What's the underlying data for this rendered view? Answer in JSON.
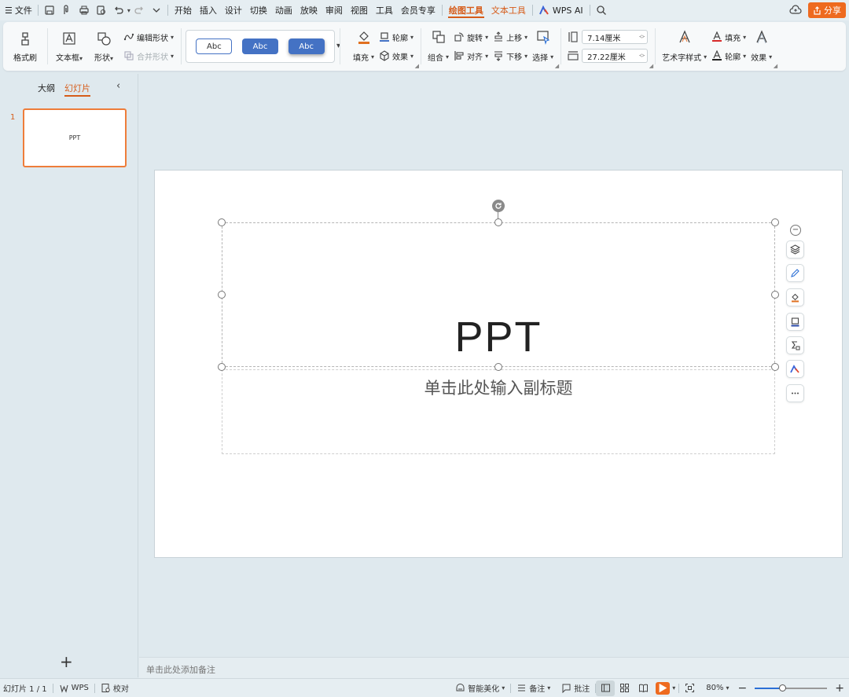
{
  "menubar": {
    "file": "文件",
    "tabs": [
      "开始",
      "插入",
      "设计",
      "切换",
      "动画",
      "放映",
      "审阅",
      "视图",
      "工具",
      "会员专享"
    ],
    "drawing_tools": "绘图工具",
    "text_tools": "文本工具",
    "wps_ai": "WPS AI",
    "share": "分享"
  },
  "ribbon": {
    "format_painter": "格式刷",
    "textbox": "文本框",
    "shape": "形状",
    "edit_shape": "编辑形状",
    "merge_shape": "合并形状",
    "style_samples": [
      "Abc",
      "Abc",
      "Abc"
    ],
    "fill": "填充",
    "outline": "轮廓",
    "effect": "效果",
    "group": "组合",
    "rotate": "旋转",
    "align": "对齐",
    "bring_forward": "上移",
    "send_backward": "下移",
    "select": "选择",
    "height_value": "7.14厘米",
    "width_value": "27.22厘米",
    "art_text_style": "艺术字样式",
    "text_fill": "填充",
    "text_outline": "轮廓",
    "text_effect": "效果"
  },
  "leftpanel": {
    "tab_outline": "大纲",
    "tab_slides": "幻灯片",
    "slide_number": "1",
    "thumbnail_title": "PPT"
  },
  "slide": {
    "title": "PPT",
    "subtitle_placeholder": "单击此处输入副标题"
  },
  "notes": {
    "placeholder": "单击此处添加备注"
  },
  "status": {
    "slide_count": "幻灯片 1 / 1",
    "wps": "WPS",
    "proofread": "校对",
    "smart_beautify": "智能美化",
    "notes": "备注",
    "comments": "批注",
    "zoom": "80%",
    "zoom_fraction": 0.8
  },
  "colors": {
    "accent": "#d65c1a",
    "share_bg": "#ee6a1f",
    "style_blue": "#4472c4"
  }
}
